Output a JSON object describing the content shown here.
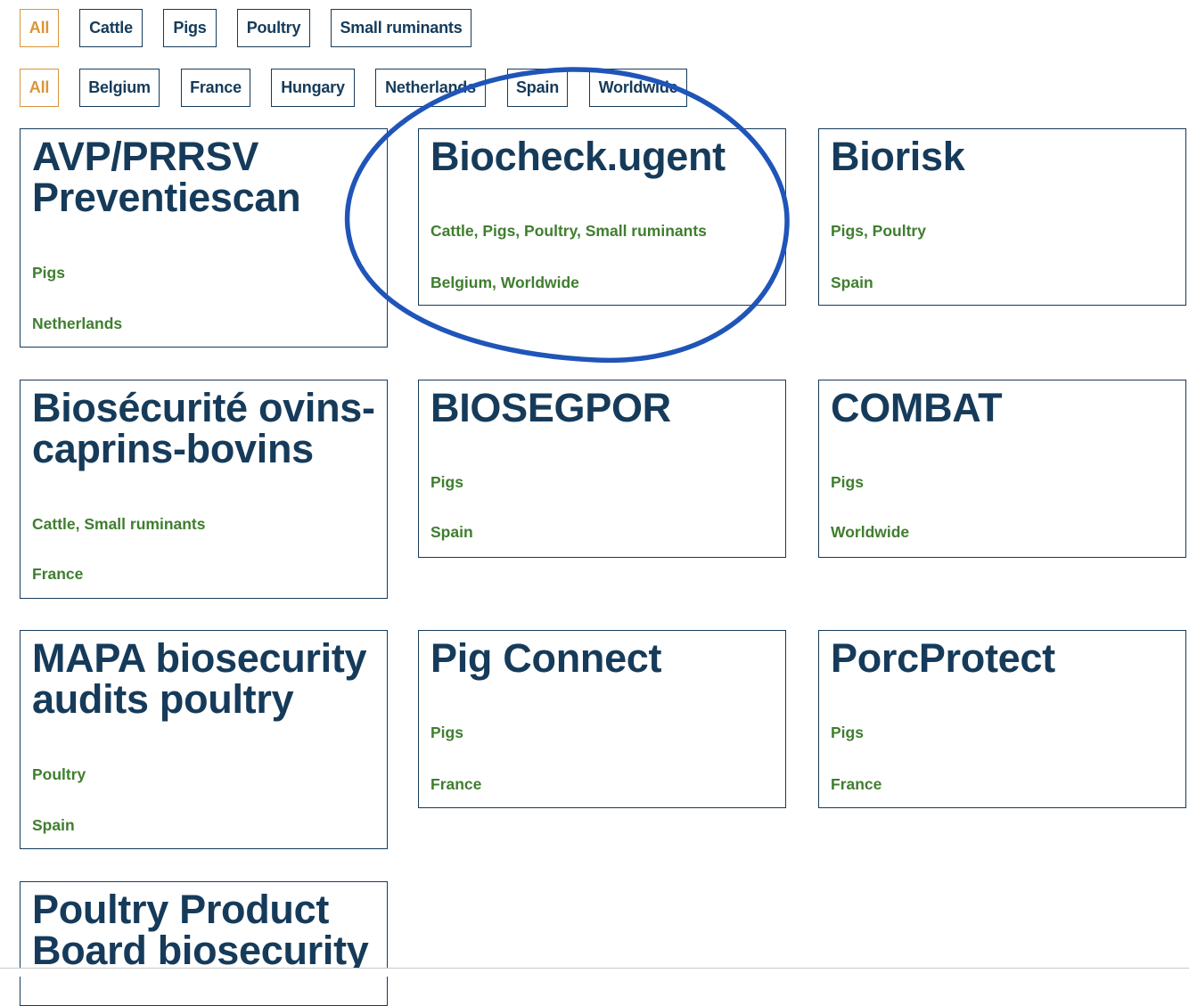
{
  "species_filters": [
    {
      "label": "All",
      "active": true
    },
    {
      "label": "Cattle",
      "active": false
    },
    {
      "label": "Pigs",
      "active": false
    },
    {
      "label": "Poultry",
      "active": false
    },
    {
      "label": "Small ruminants",
      "active": false
    }
  ],
  "country_filters": [
    {
      "label": "All",
      "active": true
    },
    {
      "label": "Belgium",
      "active": false
    },
    {
      "label": "France",
      "active": false
    },
    {
      "label": "Hungary",
      "active": false
    },
    {
      "label": "Netherlands",
      "active": false
    },
    {
      "label": "Spain",
      "active": false
    },
    {
      "label": "Worldwide",
      "active": false
    }
  ],
  "cards": [
    {
      "title": "AVP/PRRSV Preventiescan",
      "species": "Pigs",
      "countries": "Netherlands"
    },
    {
      "title": "Biocheck.ugent",
      "species": "Cattle, Pigs, Poultry, Small ruminants",
      "countries": "Belgium, Worldwide"
    },
    {
      "title": "Biorisk",
      "species": "Pigs, Poultry",
      "countries": "Spain"
    },
    {
      "title": "Biosécurité ovins-caprins-bovins",
      "species": "Cattle, Small ruminants",
      "countries": "France"
    },
    {
      "title": "BIOSEGPOR",
      "species": "Pigs",
      "countries": "Spain"
    },
    {
      "title": "COMBAT",
      "species": "Pigs",
      "countries": "Worldwide"
    },
    {
      "title": "MAPA biosecurity audits poultry",
      "species": "Poultry",
      "countries": "Spain"
    },
    {
      "title": "Pig Connect",
      "species": "Pigs",
      "countries": "France"
    },
    {
      "title": "PorcProtect",
      "species": "Pigs",
      "countries": "France"
    },
    {
      "title": "Poultry Product Board biosecurity",
      "species": "",
      "countries": ""
    }
  ],
  "colors": {
    "navy": "#163b5a",
    "accent_orange": "#d9953a",
    "tag_green": "#3f7e2f",
    "annotation_blue": "#1f55b8"
  }
}
